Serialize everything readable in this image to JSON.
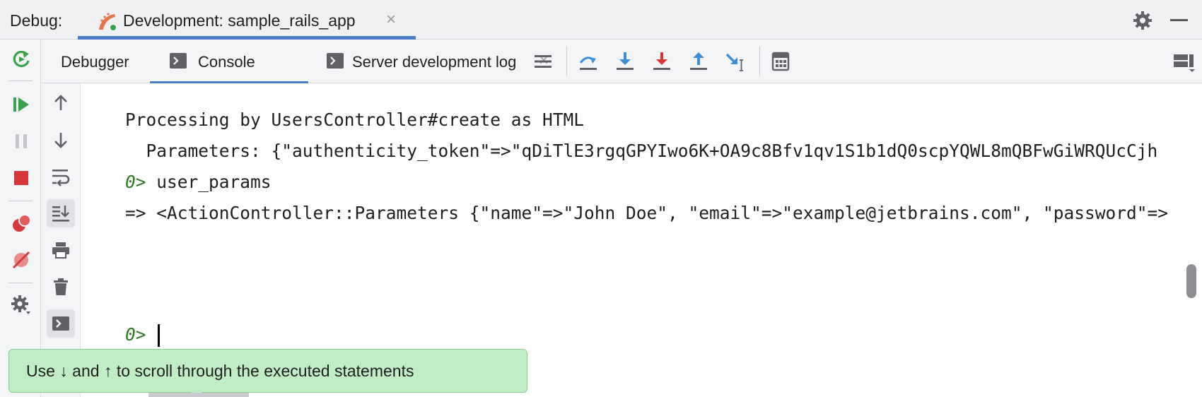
{
  "titlebar": {
    "debug_label": "Debug:",
    "session_tab": "Development: sample_rails_app",
    "session_close": "×"
  },
  "tabs": [
    {
      "label": "Debugger"
    },
    {
      "label": "Console"
    },
    {
      "label": "Server development log",
      "close": "×"
    }
  ],
  "console": {
    "lines": [
      {
        "text": "Processing by UsersController#create as HTML"
      },
      {
        "text": "  Parameters: {\"authenticity_token\"=>\"qDiTlE3rgqGPYIwo6K+OA9c8Bfv1qv1S1b1dQ0scpYQWL8mQBFwGiWRQUcCjh"
      },
      {
        "prompt": "0>",
        "text": " user_params"
      },
      {
        "text": "=> <ActionController::Parameters {\"name\"=>\"John Doe\", \"email\"=>\"example@jetbrains.com\", \"password\"=>"
      }
    ],
    "input_prompt": "0>"
  },
  "tooltip": {
    "text": "Use ↓ and ↑ to scroll through the executed statements"
  },
  "colors": {
    "accent": "#4a7ec9",
    "prompt": "#2a7a23",
    "tooltip_bg": "#bfeec4",
    "resume_green": "#3aa34a",
    "stop_red": "#d9383a",
    "step_blue": "#3a8fd8"
  },
  "icons": {
    "left_toolbar": [
      "rerun-icon",
      "resume-icon",
      "pause-icon",
      "stop-icon",
      "view-breakpoints-icon",
      "mute-breakpoints-icon",
      "settings-icon"
    ],
    "tab_toolbar": [
      "threads-icon",
      "step-over-icon",
      "step-into-icon",
      "force-step-into-icon",
      "step-out-icon",
      "run-to-cursor-icon",
      "evaluate-expression-icon",
      "layout-icon"
    ],
    "console_toolbar": [
      "scroll-up-icon",
      "scroll-down-icon",
      "soft-wrap-icon",
      "scroll-to-end-icon",
      "print-icon",
      "clear-all-icon",
      "console-input-icon"
    ]
  }
}
